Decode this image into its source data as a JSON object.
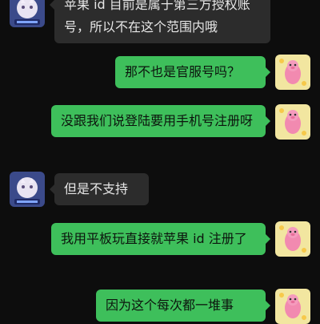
{
  "messages": [
    {
      "sender": "other",
      "avatar": "anime-girl-avatar",
      "text": "苹果 id 目前是属于第三方授权账号，所以不在这个范围内哦"
    },
    {
      "sender": "me",
      "avatar": "pink-pig-sticker-avatar",
      "text": "那不也是官服号吗？"
    },
    {
      "sender": "me",
      "avatar": "pink-pig-sticker-avatar",
      "text": "没跟我们说登陆要用手机号注册呀"
    },
    {
      "sender": "other",
      "avatar": "anime-girl-avatar",
      "text": "但是不支持"
    },
    {
      "sender": "me",
      "avatar": "pink-pig-sticker-avatar",
      "text": "我用平板玩直接就苹果 id 注册了"
    },
    {
      "sender": "me",
      "avatar": "pink-pig-sticker-avatar",
      "text": "因为这个每次都一堆事"
    }
  ],
  "colors": {
    "background": "#0d0d0d",
    "incoming_bubble": "#2c2c2c",
    "outgoing_bubble": "#3ebf5b"
  }
}
